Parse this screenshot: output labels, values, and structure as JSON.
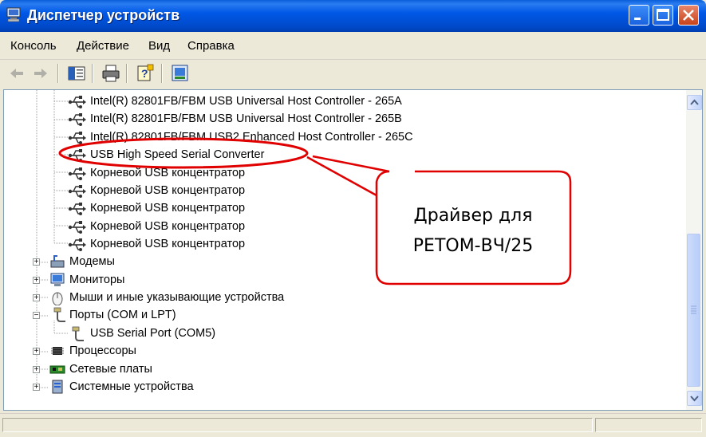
{
  "window": {
    "title": "Диспетчер устройств"
  },
  "menu": [
    "Консоль",
    "Действие",
    "Вид",
    "Справка"
  ],
  "toolbar_icons": [
    "back-icon",
    "forward-icon",
    "show-hide-tree-icon",
    "print-icon",
    "help-icon",
    "properties-icon"
  ],
  "usb_devices": [
    "Intel(R) 82801FB/FBM USB Universal Host Controller - 265A",
    "Intel(R) 82801FB/FBM USB Universal Host Controller - 265B",
    "Intel(R) 82801FB/FBM USB2 Enhanced Host Controller - 265C",
    "USB High Speed Serial Converter",
    "Корневой USB концентратор",
    "Корневой USB концентратор",
    "Корневой USB концентратор",
    "Корневой USB концентратор",
    "Корневой USB концентратор"
  ],
  "categories": [
    {
      "label": "Модемы",
      "icon": "modem-icon",
      "expanded": false
    },
    {
      "label": "Мониторы",
      "icon": "monitor-icon",
      "expanded": false
    },
    {
      "label": "Мыши и иные указывающие устройства",
      "icon": "mouse-icon",
      "expanded": false
    },
    {
      "label": "Порты (COM и LPT)",
      "icon": "port-icon",
      "expanded": true
    },
    {
      "label": "Процессоры",
      "icon": "cpu-icon",
      "expanded": false
    },
    {
      "label": "Сетевые платы",
      "icon": "network-card-icon",
      "expanded": false
    },
    {
      "label": "Системные устройства",
      "icon": "system-device-icon",
      "expanded": false
    }
  ],
  "port_child": "USB Serial Port (COM5)",
  "callout": {
    "line1": "Драйвер для",
    "line2": "РЕТОМ-ВЧ/25",
    "color": "#e00000"
  },
  "colors": {
    "titlebar": "#0058e6",
    "highlight": "#e00000"
  }
}
